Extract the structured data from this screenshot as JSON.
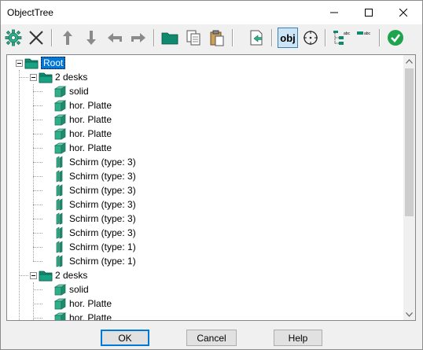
{
  "window": {
    "title": "ObjectTree"
  },
  "toolbar": {
    "obj_label": "obj",
    "icons": [
      "gear-icon",
      "delete-x-icon",
      "move-up-icon",
      "move-down-icon",
      "move-left-icon",
      "move-right-icon",
      "folder-icon",
      "copy-icon",
      "paste-icon",
      "export-icon",
      "obj-toggle-icon",
      "target-icon",
      "tree-labels-icon",
      "labels-icon",
      "confirm-check-icon"
    ]
  },
  "tree": {
    "nodes": [
      {
        "label": "Root",
        "type": "folder",
        "level": 0,
        "selected": true
      },
      {
        "label": "2 desks",
        "type": "folder",
        "level": 1
      },
      {
        "label": "solid",
        "type": "solid",
        "level": 2
      },
      {
        "label": "hor. Platte",
        "type": "solid",
        "level": 2
      },
      {
        "label": "hor. Platte",
        "type": "solid",
        "level": 2
      },
      {
        "label": "hor. Platte",
        "type": "solid",
        "level": 2
      },
      {
        "label": "hor. Platte",
        "type": "solid",
        "level": 2
      },
      {
        "label": "Schirm (type: 3)",
        "type": "panel",
        "level": 2
      },
      {
        "label": "Schirm (type: 3)",
        "type": "panel",
        "level": 2
      },
      {
        "label": "Schirm (type: 3)",
        "type": "panel",
        "level": 2
      },
      {
        "label": "Schirm (type: 3)",
        "type": "panel",
        "level": 2
      },
      {
        "label": "Schirm (type: 3)",
        "type": "panel",
        "level": 2
      },
      {
        "label": "Schirm (type: 3)",
        "type": "panel",
        "level": 2
      },
      {
        "label": "Schirm (type: 1)",
        "type": "panel",
        "level": 2
      },
      {
        "label": "Schirm (type: 1)",
        "type": "panel",
        "level": 2
      },
      {
        "label": "2 desks",
        "type": "folder",
        "level": 1
      },
      {
        "label": "solid",
        "type": "solid",
        "level": 2
      },
      {
        "label": "hor. Platte",
        "type": "solid",
        "level": 2
      },
      {
        "label": "hor. Platte",
        "type": "solid",
        "level": 2
      }
    ]
  },
  "buttons": {
    "ok": "OK",
    "cancel": "Cancel",
    "help": "Help"
  },
  "colors": {
    "selection": "#0078d7",
    "folder": "#0f8a6e",
    "solid": "#2fae8a",
    "check": "#1ea44c"
  }
}
